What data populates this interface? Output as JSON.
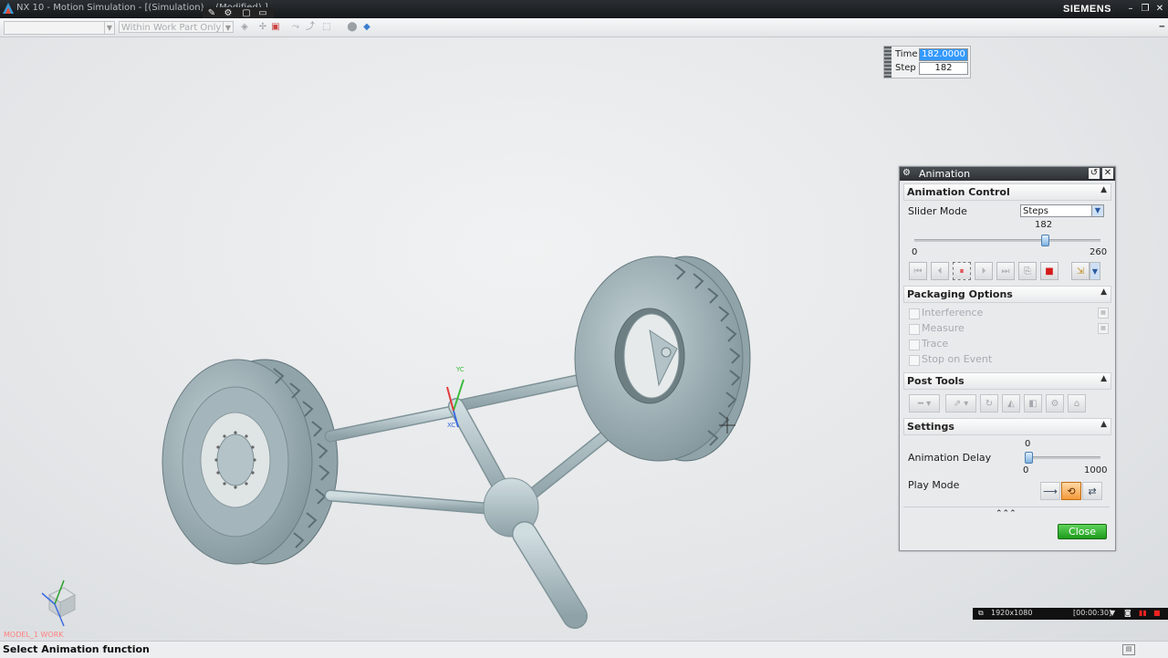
{
  "window": {
    "title": "NX 10 - Motion Simulation - [(Simulation) ...(Modified) ]",
    "brand": "SIEMENS",
    "minimize": "–",
    "restore": "❐",
    "close": "✕"
  },
  "quick_access": [
    "✎",
    "⚙",
    "▢",
    "▭"
  ],
  "toolbar": {
    "filter_value": "",
    "scope_value": "Within Work Part Only"
  },
  "time_step": {
    "time_label": "Time",
    "time_value": "182.0000",
    "step_label": "Step",
    "step_value": "182"
  },
  "animation_dialog": {
    "title": "Animation",
    "animation_control": {
      "header": "Animation Control",
      "slider_mode_label": "Slider Mode",
      "slider_mode_value": "Steps",
      "slider_current": "182",
      "slider_min": "0",
      "slider_max": "260",
      "slider_fraction": 0.7
    },
    "packaging_options": {
      "header": "Packaging Options",
      "items": [
        {
          "label": "Interference",
          "checked": false
        },
        {
          "label": "Measure",
          "checked": false
        },
        {
          "label": "Trace",
          "checked": false
        },
        {
          "label": "Stop on Event",
          "checked": false
        }
      ]
    },
    "post_tools": {
      "header": "Post Tools"
    },
    "settings": {
      "header": "Settings",
      "delay_label": "Animation Delay",
      "delay_current": "0",
      "delay_min": "0",
      "delay_max": "1000",
      "play_mode_label": "Play Mode"
    },
    "close_label": "Close",
    "expander": "⌃⌃⌃"
  },
  "viewport": {
    "triad_label": "MODEL_1 WORK",
    "csys_labels": [
      "YC",
      "XC"
    ]
  },
  "status": {
    "message": "Select Animation function"
  },
  "recorder": {
    "resolution": "1920x1080",
    "time": "[00:00:30]"
  },
  "colors": {
    "part_fill": "#a9bcc2",
    "part_dark": "#7e9197",
    "close_button": "#2aa827"
  }
}
